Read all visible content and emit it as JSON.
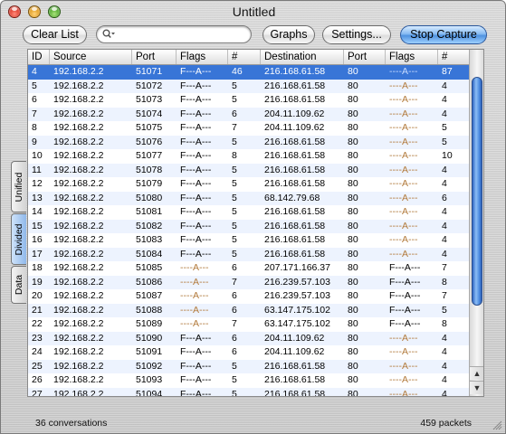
{
  "window": {
    "title": "Untitled"
  },
  "toolbar": {
    "clear_list": "Clear List",
    "search_placeholder": "",
    "graphs": "Graphs",
    "settings": "Settings...",
    "stop_capture": "Stop Capture"
  },
  "side_tabs": [
    "Unified",
    "Divided",
    "Data"
  ],
  "active_side_tab": "Divided",
  "table": {
    "columns": [
      "ID",
      "Source",
      "Port",
      "Flags",
      "#",
      "Destination",
      "Port",
      "Flags",
      "#"
    ],
    "selected_row": 0,
    "rows": [
      [
        "4",
        "192.168.2.2",
        "51071",
        "F---A---",
        "46",
        "216.168.61.58",
        "80",
        "----A---",
        "87"
      ],
      [
        "5",
        "192.168.2.2",
        "51072",
        "F---A---",
        "5",
        "216.168.61.58",
        "80",
        "----A---",
        "4"
      ],
      [
        "6",
        "192.168.2.2",
        "51073",
        "F---A---",
        "5",
        "216.168.61.58",
        "80",
        "----A---",
        "4"
      ],
      [
        "7",
        "192.168.2.2",
        "51074",
        "F---A---",
        "6",
        "204.11.109.62",
        "80",
        "----A---",
        "4"
      ],
      [
        "8",
        "192.168.2.2",
        "51075",
        "F---A---",
        "7",
        "204.11.109.62",
        "80",
        "----A---",
        "5"
      ],
      [
        "9",
        "192.168.2.2",
        "51076",
        "F---A---",
        "5",
        "216.168.61.58",
        "80",
        "----A---",
        "5"
      ],
      [
        "10",
        "192.168.2.2",
        "51077",
        "F---A---",
        "8",
        "216.168.61.58",
        "80",
        "----A---",
        "10"
      ],
      [
        "11",
        "192.168.2.2",
        "51078",
        "F---A---",
        "5",
        "216.168.61.58",
        "80",
        "----A---",
        "4"
      ],
      [
        "12",
        "192.168.2.2",
        "51079",
        "F---A---",
        "5",
        "216.168.61.58",
        "80",
        "----A---",
        "4"
      ],
      [
        "13",
        "192.168.2.2",
        "51080",
        "F---A---",
        "5",
        "68.142.79.68",
        "80",
        "----A---",
        "6"
      ],
      [
        "14",
        "192.168.2.2",
        "51081",
        "F---A---",
        "5",
        "216.168.61.58",
        "80",
        "----A---",
        "4"
      ],
      [
        "15",
        "192.168.2.2",
        "51082",
        "F---A---",
        "5",
        "216.168.61.58",
        "80",
        "----A---",
        "4"
      ],
      [
        "16",
        "192.168.2.2",
        "51083",
        "F---A---",
        "5",
        "216.168.61.58",
        "80",
        "----A---",
        "4"
      ],
      [
        "17",
        "192.168.2.2",
        "51084",
        "F---A---",
        "5",
        "216.168.61.58",
        "80",
        "----A---",
        "4"
      ],
      [
        "18",
        "192.168.2.2",
        "51085",
        "----A---",
        "6",
        "207.171.166.37",
        "80",
        "F---A---",
        "7"
      ],
      [
        "19",
        "192.168.2.2",
        "51086",
        "----A---",
        "7",
        "216.239.57.103",
        "80",
        "F---A---",
        "8"
      ],
      [
        "20",
        "192.168.2.2",
        "51087",
        "----A---",
        "6",
        "216.239.57.103",
        "80",
        "F---A---",
        "7"
      ],
      [
        "21",
        "192.168.2.2",
        "51088",
        "----A---",
        "6",
        "63.147.175.102",
        "80",
        "F---A---",
        "5"
      ],
      [
        "22",
        "192.168.2.2",
        "51089",
        "----A---",
        "7",
        "63.147.175.102",
        "80",
        "F---A---",
        "8"
      ],
      [
        "23",
        "192.168.2.2",
        "51090",
        "F---A---",
        "6",
        "204.11.109.62",
        "80",
        "----A---",
        "4"
      ],
      [
        "24",
        "192.168.2.2",
        "51091",
        "F---A---",
        "6",
        "204.11.109.62",
        "80",
        "----A---",
        "4"
      ],
      [
        "25",
        "192.168.2.2",
        "51092",
        "F---A---",
        "5",
        "216.168.61.58",
        "80",
        "----A---",
        "4"
      ],
      [
        "26",
        "192.168.2.2",
        "51093",
        "F---A---",
        "5",
        "216.168.61.58",
        "80",
        "----A---",
        "4"
      ],
      [
        "27",
        "192.168.2.2",
        "51094",
        "F---A---",
        "5",
        "216.168.61.58",
        "80",
        "----A---",
        "4"
      ]
    ]
  },
  "status": {
    "conversations": "36 conversations",
    "packets": "459 packets"
  },
  "colors": {
    "selection": "#3875d7",
    "alt_row": "#edf3fe",
    "data_flag": "#b27a3b"
  }
}
